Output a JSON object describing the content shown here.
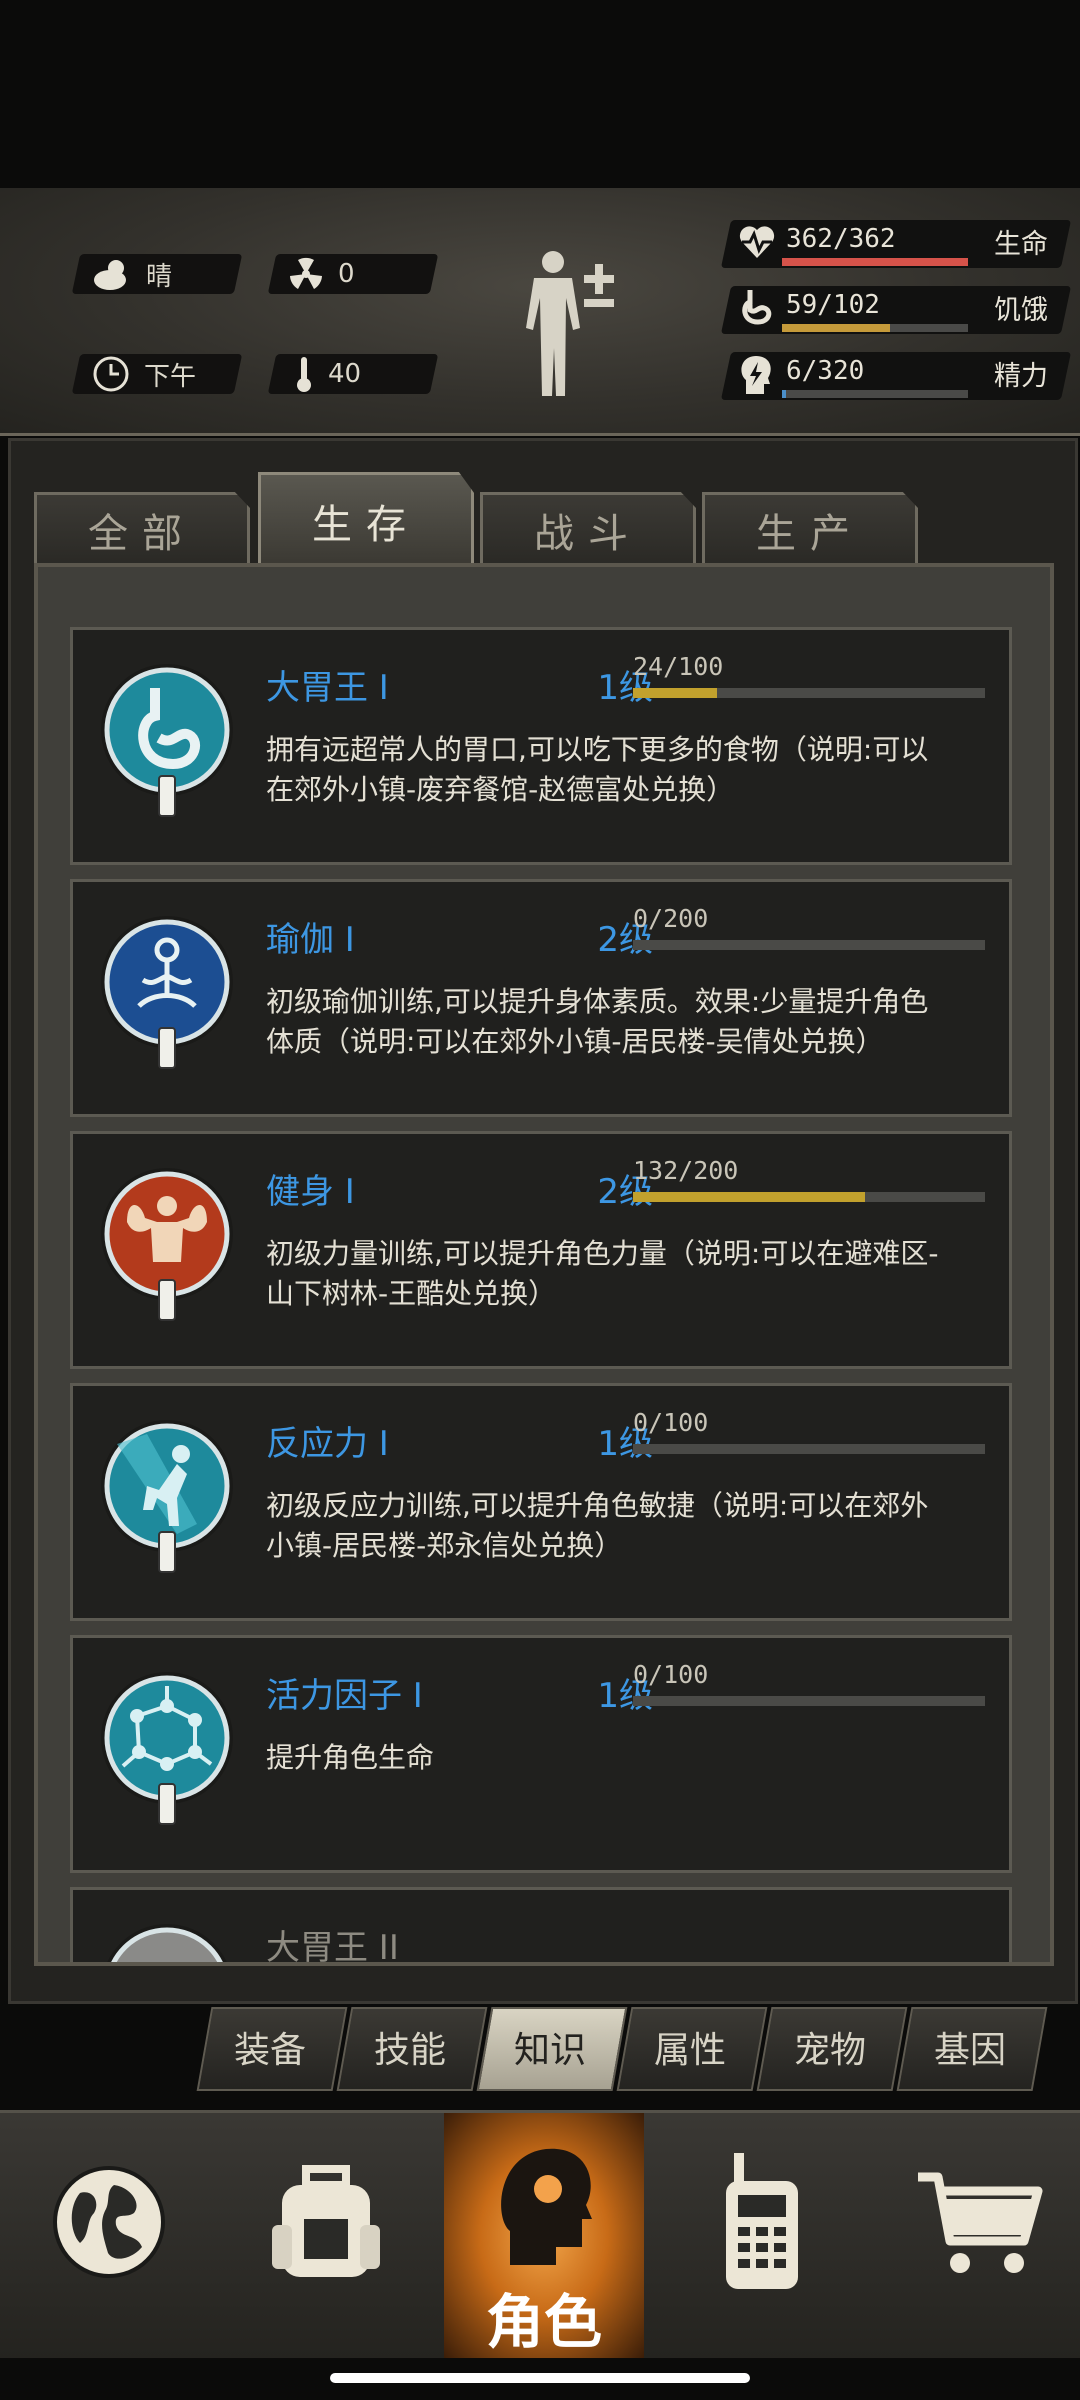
{
  "status": {
    "weather": "晴",
    "radiation": "0",
    "time_of_day": "下午",
    "temperature": "40",
    "stats": [
      {
        "name": "life",
        "icon": "heart-pulse-icon",
        "text": "362/362",
        "label": "生命",
        "fraction": 1.0,
        "color": "#d6534a"
      },
      {
        "name": "hunger",
        "icon": "stomach-icon",
        "text": "59/102",
        "label": "饥饿",
        "fraction": 0.578,
        "color": "#c59a3a"
      },
      {
        "name": "energy",
        "icon": "head-bolt-icon",
        "text": "6/320",
        "label": "精力",
        "fraction": 0.019,
        "color": "#4b8fc9"
      }
    ]
  },
  "tabs": [
    "全部",
    "生存",
    "战斗",
    "生产"
  ],
  "active_tab": 1,
  "skills": [
    {
      "name": "大胃王 I",
      "level": "1级",
      "progress": "24/100",
      "fraction": 0.24,
      "desc": "拥有远超常人的胃口,可以吃下更多的食物（说明:可以在郊外小镇-废弃餐馆-赵德富处兑换）",
      "icon": "stomach-skill-icon",
      "color": "#1e8a9c"
    },
    {
      "name": "瑜伽 I",
      "level": "2级",
      "progress": "0/200",
      "fraction": 0,
      "desc": "初级瑜伽训练,可以提升身体素质。效果:少量提升角色体质（说明:可以在郊外小镇-居民楼-吴倩处兑换）",
      "icon": "yoga-skill-icon",
      "color": "#1c4e92"
    },
    {
      "name": "健身 I",
      "level": "2级",
      "progress": "132/200",
      "fraction": 0.66,
      "desc": "初级力量训练,可以提升角色力量（说明:可以在避难区-山下树林-王酷处兑换）",
      "icon": "muscle-skill-icon",
      "color": "#b33a1c"
    },
    {
      "name": "反应力 I",
      "level": "1级",
      "progress": "0/100",
      "fraction": 0,
      "desc": "初级反应力训练,可以提升角色敏捷（说明:可以在郊外小镇-居民楼-郑永信处兑换）",
      "icon": "reflex-skill-icon",
      "color": "#1e8a9c"
    },
    {
      "name": "活力因子 I",
      "level": "1级",
      "progress": "0/100",
      "fraction": 0,
      "desc": "提升角色生命",
      "icon": "molecule-skill-icon",
      "color": "#1e8a9c"
    },
    {
      "name": "大胃王 II",
      "level": "",
      "progress": "",
      "fraction": 0,
      "desc": "",
      "icon": "stomach-skill-icon",
      "color": "#888888"
    }
  ],
  "subtabs": [
    "装备",
    "技能",
    "知识",
    "属性",
    "宠物",
    "基因"
  ],
  "active_subtab": 2,
  "nav": [
    {
      "icon": "globe-icon",
      "label": ""
    },
    {
      "icon": "backpack-icon",
      "label": ""
    },
    {
      "icon": "character-head-icon",
      "label": "角色"
    },
    {
      "icon": "walkie-talkie-icon",
      "label": ""
    },
    {
      "icon": "shopping-cart-icon",
      "label": ""
    }
  ],
  "active_nav": 2
}
